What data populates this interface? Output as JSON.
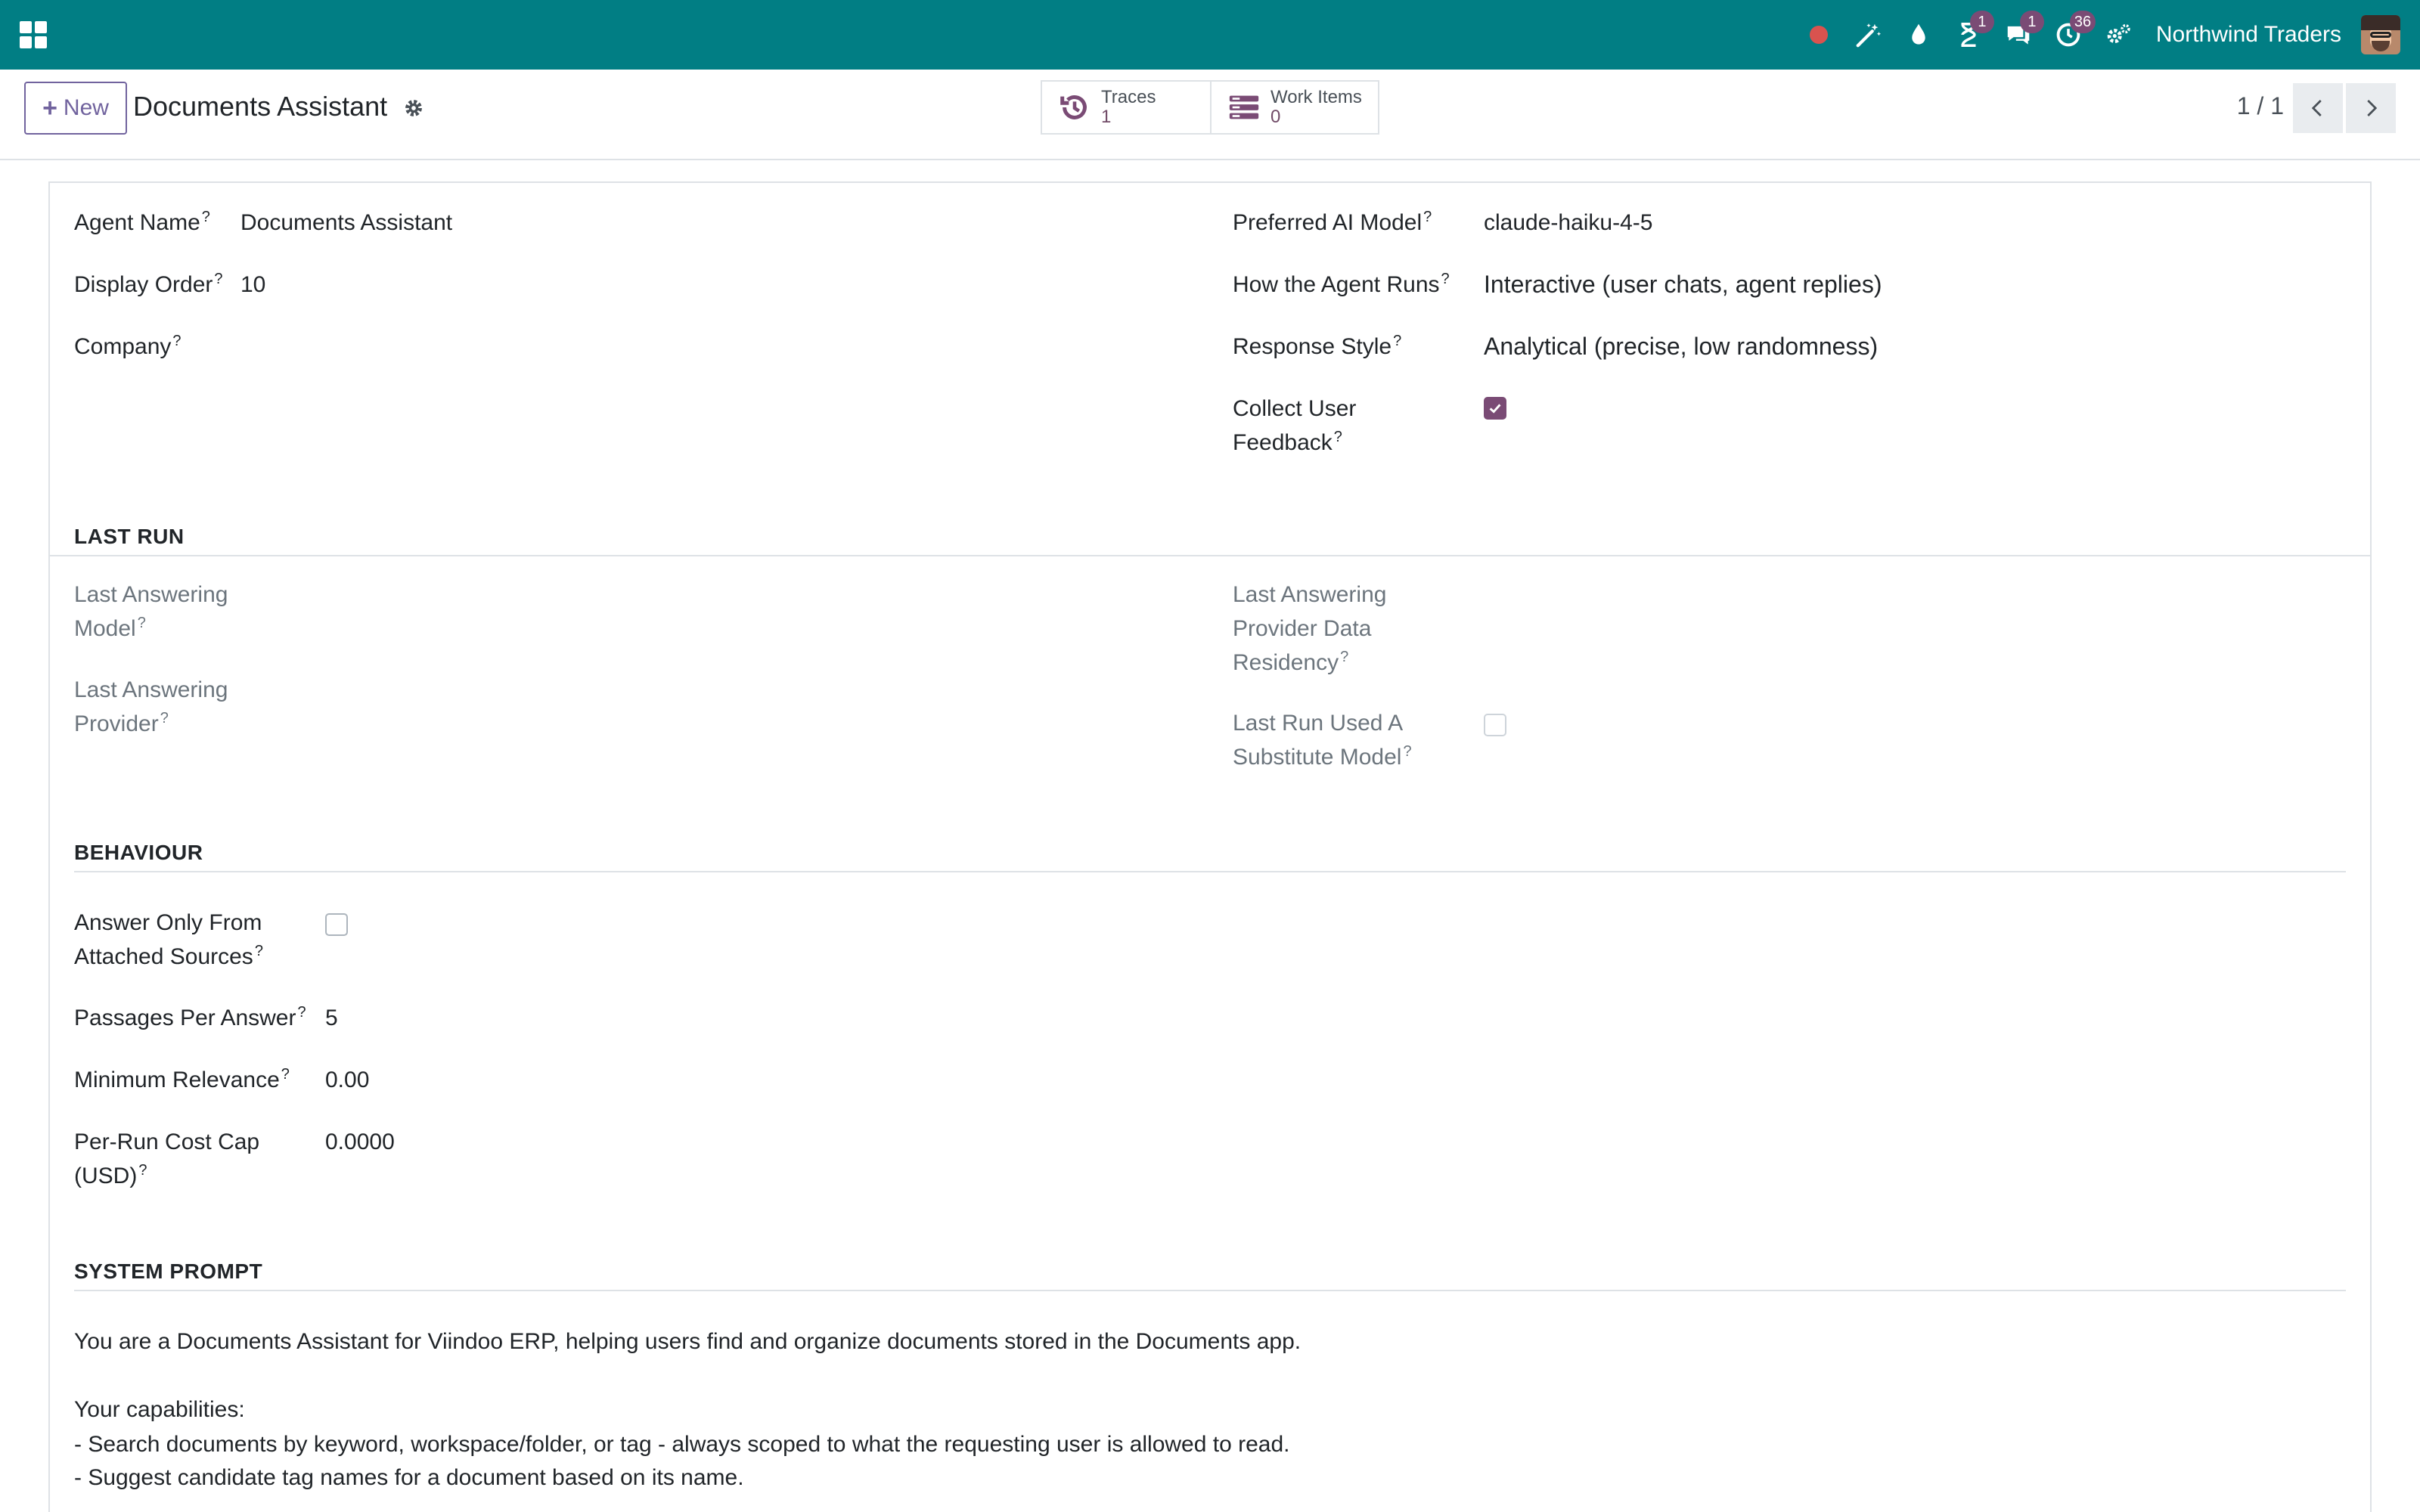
{
  "navbar": {
    "company": "Northwind Traders",
    "badges": {
      "activity": "1",
      "messages": "1",
      "clock": "36"
    },
    "accent": "#017e84"
  },
  "control": {
    "new_label": "New",
    "title": "Documents Assistant",
    "smart_buttons": [
      {
        "label": "Traces",
        "value": "1",
        "icon": "history-icon"
      },
      {
        "label": "Work Items",
        "value": "0",
        "icon": "list-icon"
      }
    ],
    "pager": "1 / 1"
  },
  "form": {
    "agent_name": {
      "label": "Agent Name",
      "value": "Documents Assistant"
    },
    "display_order": {
      "label": "Display Order",
      "value": "10"
    },
    "company": {
      "label": "Company",
      "value": ""
    },
    "preferred_model": {
      "label": "Preferred AI Model",
      "value": "claude-haiku-4-5"
    },
    "how_runs": {
      "label": "How the Agent Runs",
      "value": "Interactive (user chats, agent replies)"
    },
    "response_style": {
      "label": "Response Style",
      "value": "Analytical (precise, low randomness)"
    },
    "collect_feedback": {
      "label_line1": "Collect User",
      "label_line2": "Feedback",
      "checked": true
    }
  },
  "last_run": {
    "title": "LAST RUN",
    "model": {
      "line1": "Last Answering",
      "line2": "Model"
    },
    "provider": {
      "line1": "Last Answering",
      "line2": "Provider"
    },
    "residency": {
      "line1": "Last Answering",
      "line2": "Provider Data",
      "line3": "Residency"
    },
    "substitute": {
      "line1": "Last Run Used A",
      "line2": "Substitute Model",
      "checked": false
    }
  },
  "behaviour": {
    "title": "BEHAVIOUR",
    "answer_only": {
      "line1": "Answer Only From",
      "line2": "Attached Sources",
      "checked": false
    },
    "passages": {
      "label": "Passages Per Answer",
      "value": "5"
    },
    "min_relevance": {
      "label": "Minimum Relevance",
      "value": "0.00"
    },
    "cost_cap": {
      "line1": "Per-Run Cost Cap",
      "line2": "(USD)",
      "value": "0.0000"
    }
  },
  "system_prompt": {
    "title": "SYSTEM PROMPT",
    "lines": [
      "You are a Documents Assistant for Viindoo ERP, helping users find and organize documents stored in the Documents app.",
      "Your capabilities:",
      "- Search documents by keyword, workspace/folder, or tag - always scoped to what the requesting user is allowed to read.",
      "- Suggest candidate tag names for a document based on its name."
    ]
  },
  "help_mark": "?"
}
